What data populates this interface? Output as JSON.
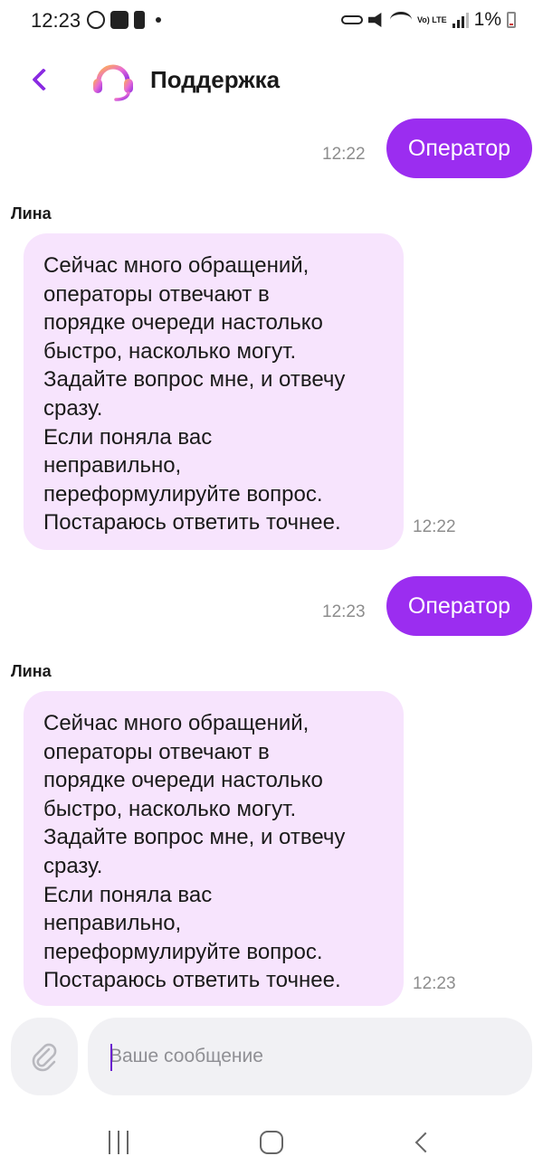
{
  "status_bar": {
    "time": "12:23",
    "battery": "1%",
    "lte_label": "Vo) LTE",
    "icons_left": [
      "whatsapp-icon",
      "gallery-icon",
      "battery-alert-icon",
      "dot-icon"
    ],
    "icons_right": [
      "key-icon",
      "mute-icon",
      "wifi-icon",
      "lte-icon",
      "signal-icon",
      "battery-icon"
    ]
  },
  "header": {
    "title": "Поддержка",
    "back_icon": "chevron-left-icon",
    "avatar_icon": "headset-icon"
  },
  "colors": {
    "accent": "#9b2df0",
    "incoming_bubble": "#f7e4fd",
    "time_text": "#8d8d8d"
  },
  "messages": [
    {
      "type": "outgoing",
      "text": "Оператор",
      "time": "12:22"
    },
    {
      "type": "incoming",
      "sender": "Лина",
      "text": "Сейчас много обращений,\nоператоры отвечают в\nпорядке очереди настолько\nбыстро, насколько могут.\nЗадайте вопрос мне, и отвечу\nсразу.\nЕсли поняла вас\nнеправильно,\nпереформулируйте вопрос.\nПостараюсь ответить точнее.",
      "time": "12:22"
    },
    {
      "type": "outgoing",
      "text": "Оператор",
      "time": "12:23"
    },
    {
      "type": "incoming",
      "sender": "Лина",
      "text": "Сейчас много обращений,\nоператоры отвечают в\nпорядке очереди настолько\nбыстро, насколько могут.\nЗадайте вопрос мне, и отвечу\nсразу.\nЕсли поняла вас\nнеправильно,\nпереформулируйте вопрос.\nПостараюсь ответить точнее.",
      "time": "12:23"
    }
  ],
  "composer": {
    "placeholder": "Ваше сообщение",
    "value": "",
    "attach_icon": "paperclip-icon"
  },
  "nav_bar": {
    "icons": [
      "recent-apps-icon",
      "home-icon",
      "back-icon"
    ]
  }
}
